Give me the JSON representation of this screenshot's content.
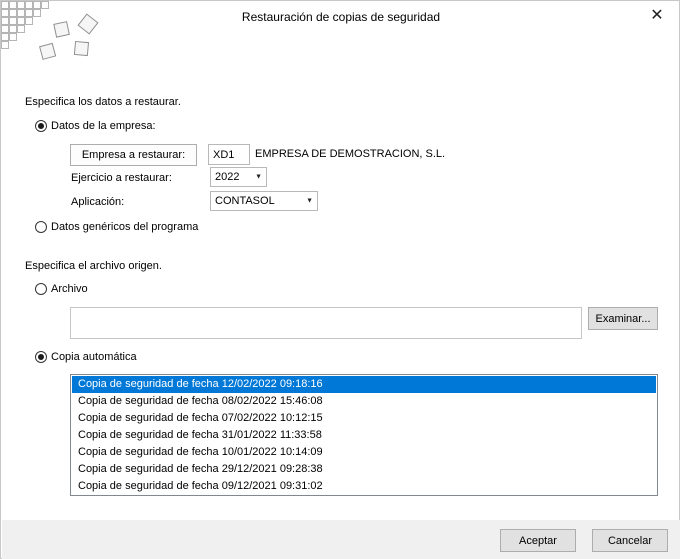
{
  "window": {
    "title": "Restauración de copias de seguridad",
    "close_glyph": "✕"
  },
  "section1": {
    "heading": "Especifica los datos a restaurar.",
    "radio_empresa_label": "Datos de la empresa:",
    "empresa_button_label": "Empresa a restaurar:",
    "empresa_code": "XD1",
    "empresa_name": "EMPRESA DE DEMOSTRACION, S.L.",
    "ejercicio_label": "Ejercicio a restaurar:",
    "ejercicio_value": "2022",
    "aplicacion_label": "Aplicación:",
    "aplicacion_value": "CONTASOL",
    "radio_genericos_label": "Datos genéricos del programa"
  },
  "section2": {
    "heading": "Especifica el archivo origen.",
    "radio_archivo_label": "Archivo",
    "archivo_path": "",
    "examinar_label": "Examinar...",
    "radio_copia_label": "Copia automática",
    "backups": [
      "Copia de seguridad de fecha 12/02/2022 09:18:16",
      "Copia de seguridad de fecha 08/02/2022 15:46:08",
      "Copia de seguridad de fecha 07/02/2022 10:12:15",
      "Copia de seguridad de fecha 31/01/2022 11:33:58",
      "Copia de seguridad de fecha 10/01/2022 10:14:09",
      "Copia de seguridad de fecha 29/12/2021 09:28:38",
      "Copia de seguridad de fecha 09/12/2021 09:31:02"
    ],
    "selected_index": 0
  },
  "footer": {
    "accept_label": "Aceptar",
    "cancel_label": "Cancelar"
  },
  "colors": {
    "selection": "#0078d7",
    "footer_bg": "#f0f0f0"
  }
}
